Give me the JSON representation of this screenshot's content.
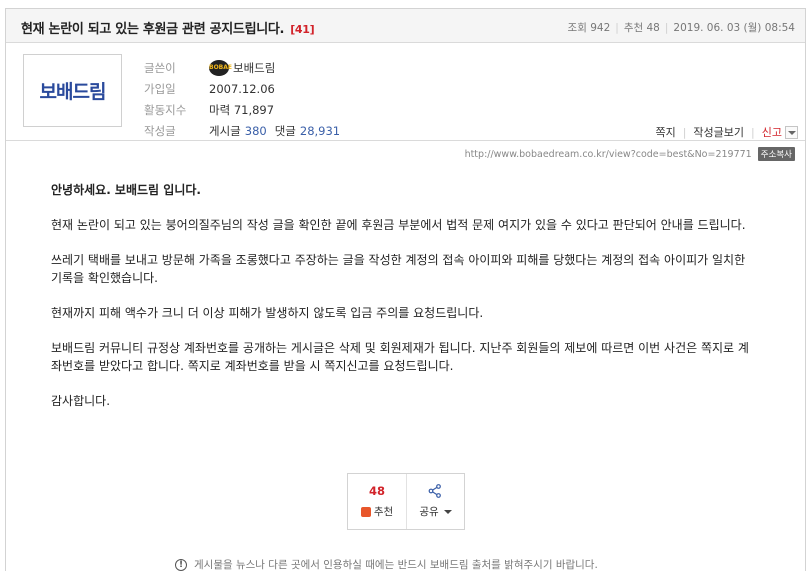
{
  "post": {
    "title": "현재 논란이 되고 있는 후원금 관련 공지드립니다.",
    "comment_count": "[41]",
    "views_label": "조회",
    "views": "942",
    "recommend_label": "추천",
    "recommend": "48",
    "date": "2019. 06. 03 (월) 08:54"
  },
  "author": {
    "logo_text": "보배드림",
    "avatar_text": "BOBAE",
    "labels": {
      "writer": "글쓴이",
      "joined": "가입일",
      "activity": "활동지수",
      "posts": "작성글"
    },
    "name": "보배드림",
    "joined": "2007.12.06",
    "activity": "마력 71,897",
    "post_label": "게시글",
    "post_count": "380",
    "comment_label": "댓글",
    "comment_count": "28,931"
  },
  "author_actions": {
    "message": "쪽지",
    "view_posts": "작성글보기",
    "report": "신고"
  },
  "url": {
    "text": "http://www.bobaedream.co.kr/view?code=best&No=219771",
    "copy_label": "주소복사"
  },
  "content": {
    "paragraphs": [
      "안녕하세요. 보배드림 입니다.",
      "현재 논란이 되고 있는 붕어의질주님의 작성 글을 확인한 끝에 후원금 부분에서 법적 문제 여지가 있을 수 있다고 판단되어 안내를 드립니다.",
      "쓰레기 택배를 보내고 방문해 가족을 조롱했다고 주장하는 글을 작성한 계정의 접속 아이피와 피해를 당했다는 계정의 접속 아이피가 일치한 기록을 확인했습니다.",
      "현재까지 피해 액수가 크니 더 이상 피해가 발생하지 않도록 입금 주의를 요청드립니다.",
      "보배드림 커뮤니티 규정상 계좌번호를 공개하는 게시글은 삭제 및 회원제재가 됩니다. 지난주 회원들의 제보에 따르면 이번 사건은 쪽지로 계좌번호를 받았다고 합니다. 쪽지로 계좌번호를 받을 시 쪽지신고를 요청드립니다.",
      "감사합니다."
    ]
  },
  "vote": {
    "count": "48",
    "recommend_label": "추천",
    "share_label": "공유"
  },
  "notice": {
    "icon_text": "!",
    "text": "게시물을 뉴스나 다른 곳에서 인용하실 때에는 반드시 보배드림 출처를 밝혀주시기 바랍니다."
  },
  "colors": {
    "accent_red": "#d2232a",
    "link_blue": "#3a5fa8",
    "logo_blue": "#2a4a9c"
  }
}
